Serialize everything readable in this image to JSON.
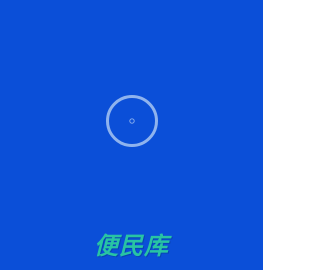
{
  "splash": {
    "brand_name": "便民库",
    "background_color": "#0b4fd8",
    "brand_color": "#28c4a3",
    "spinner_color": "#8fb3ee",
    "spinner_icon": "loading-ring-icon"
  }
}
